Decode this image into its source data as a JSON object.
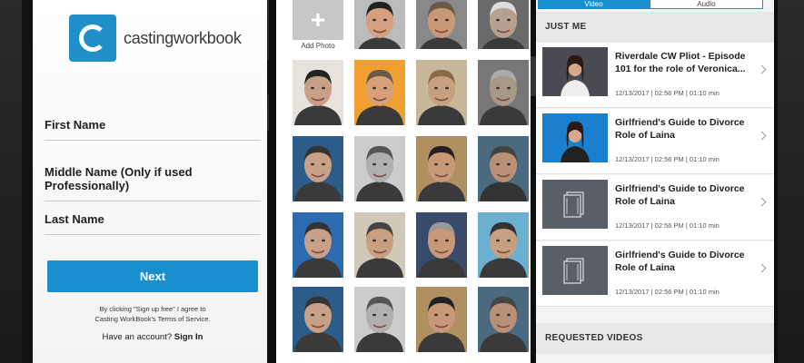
{
  "signup": {
    "logo_text": "castingworkbook",
    "fields": [
      {
        "label": "First Name"
      },
      {
        "label": "Middle Name (Only if used Professionally)"
      },
      {
        "label": "Last Name"
      }
    ],
    "next_label": "Next",
    "terms_line1": "By clicking \"Sign up free\" I agree to",
    "terms_line2": "Casting WorkBook's Terms of Service.",
    "have_account": "Have an account?",
    "sign_in": "Sign In"
  },
  "photos": {
    "add_label": "Add Photo"
  },
  "videos": {
    "tabs": [
      {
        "label": "Video"
      },
      {
        "label": "Audio"
      }
    ],
    "just_me": "JUST ME",
    "items": [
      {
        "title": "Riverdale CW Pliot - Episode 101 for the role of Veronica...",
        "meta": "12/13/2017 | 02:56 PM | 01:10 min",
        "thumb": "woman-dark"
      },
      {
        "title": "Girlfriend's Guide to Divorce Role of Laina",
        "meta": "12/13/2017 | 02:56 PM | 01:10 min",
        "thumb": "woman-blue"
      },
      {
        "title": "Girlfriend's Guide to Divorce Role of Laina",
        "meta": "12/13/2017 | 02:56 PM | 01:10 min",
        "thumb": "film-icon"
      },
      {
        "title": "Girlfriend's Guide to Divorce Role of Laina",
        "meta": "12/13/2017 | 02:56 PM | 01:10 min",
        "thumb": "film-icon"
      }
    ],
    "requested": "REQUESTED VIDEOS"
  }
}
